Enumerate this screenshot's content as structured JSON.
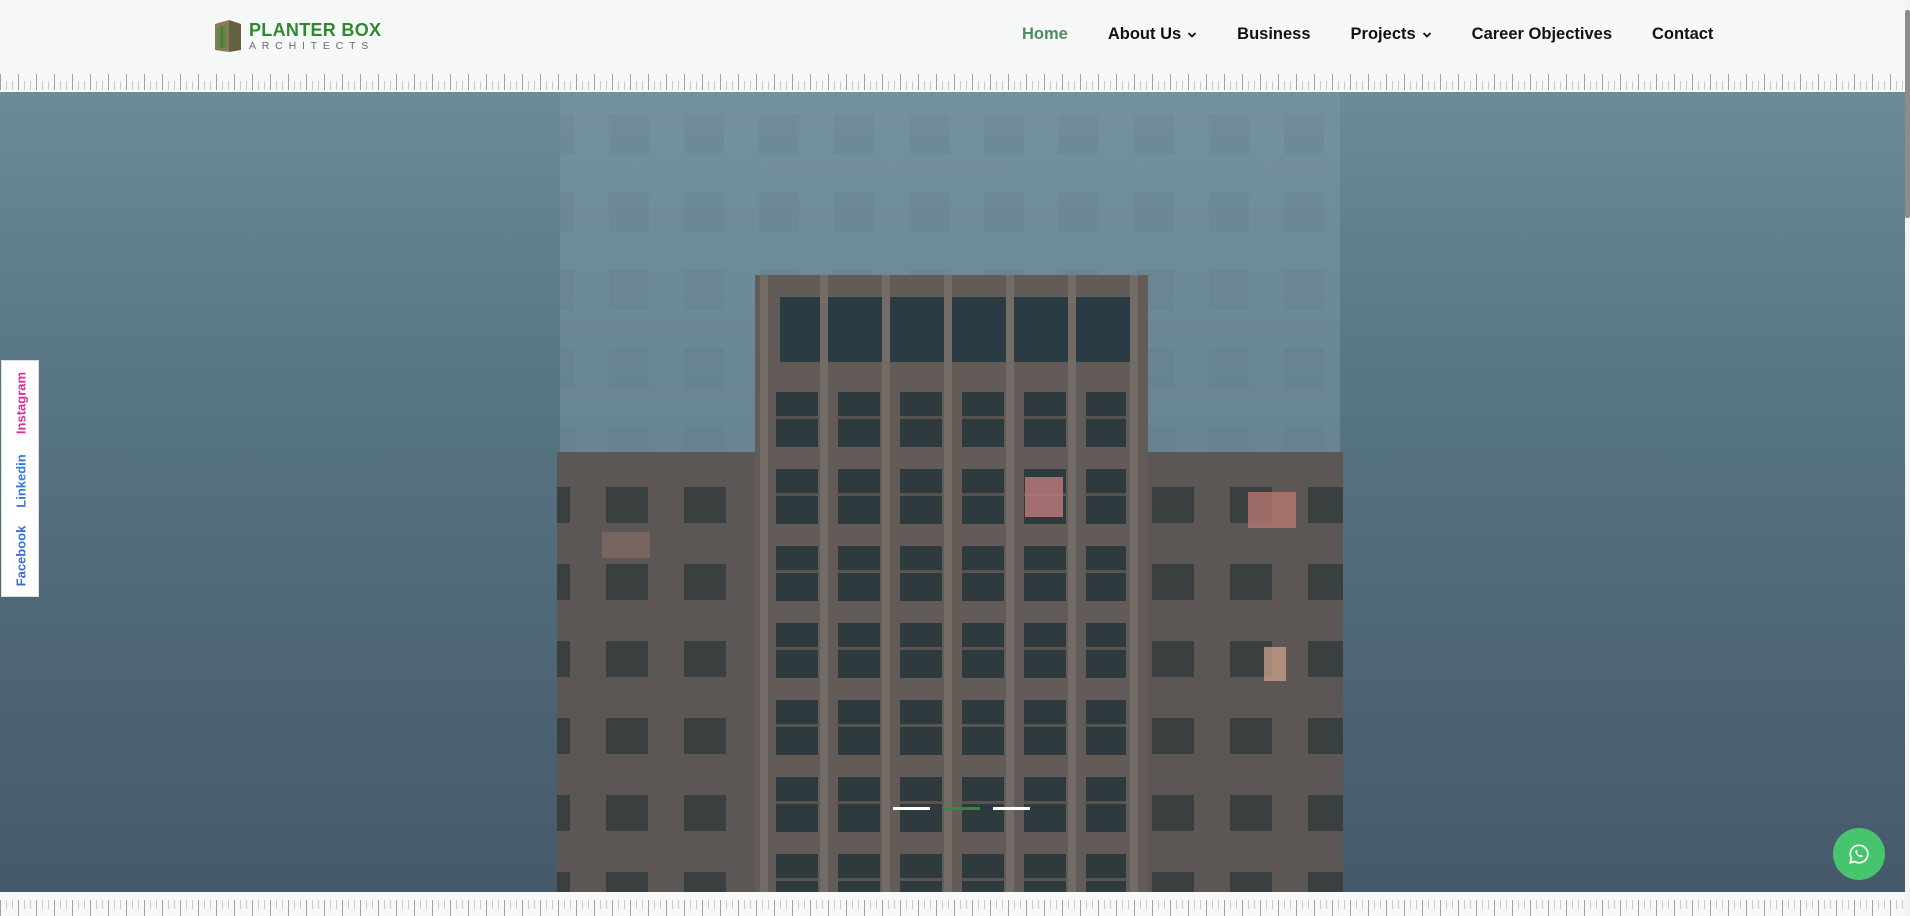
{
  "brand": {
    "title": "PLANTER BOX",
    "subtitle": "ARCHITECTS",
    "accent_color": "#2f8a2f"
  },
  "nav": {
    "items": [
      {
        "label": "Home",
        "active": true,
        "has_dropdown": false
      },
      {
        "label": "About Us",
        "active": false,
        "has_dropdown": true
      },
      {
        "label": "Business",
        "active": false,
        "has_dropdown": false
      },
      {
        "label": "Projects",
        "active": false,
        "has_dropdown": true
      },
      {
        "label": "Career Objectives",
        "active": false,
        "has_dropdown": false
      },
      {
        "label": "Contact",
        "active": false,
        "has_dropdown": false
      }
    ],
    "active_color": "#4e8b5d"
  },
  "social": {
    "facebook": "Facebook",
    "linkedin": "Linkedin",
    "instagram": "Instagram"
  },
  "slider": {
    "slide_count": 3,
    "active_index": 1,
    "active_color": "#2d8a46"
  },
  "whatsapp": {
    "icon": "whatsapp-icon",
    "color": "#47c56e"
  }
}
